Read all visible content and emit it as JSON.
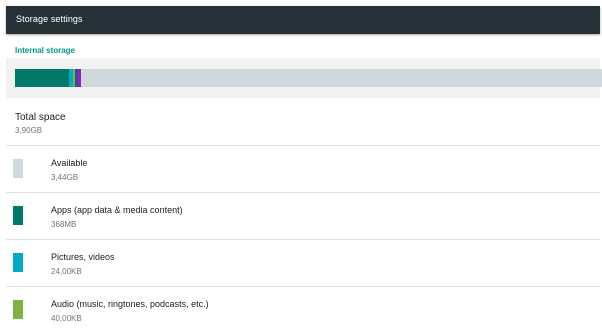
{
  "app_bar": {
    "title": "Storage settings"
  },
  "section_header": "Internal storage",
  "storage_bar": {
    "segments": [
      {
        "name": "apps",
        "fraction": 0.092,
        "color": "#00796B"
      },
      {
        "name": "pictures-videos",
        "fraction": 0.006,
        "color": "#00ACC1"
      },
      {
        "name": "audio",
        "fraction": 0.004,
        "color": "#7CB342"
      },
      {
        "name": "downloads",
        "fraction": 0.005,
        "color": "#3949AB"
      },
      {
        "name": "misc",
        "fraction": 0.005,
        "color": "#8E24AA"
      }
    ],
    "remainder_color": "#CFD8DC"
  },
  "total": {
    "label": "Total space",
    "value": "3,90GB"
  },
  "items": [
    {
      "label": "Available",
      "value": "3,44GB",
      "color": "#CFD8DC"
    },
    {
      "label": "Apps (app data & media content)",
      "value": "368MB",
      "color": "#00796B"
    },
    {
      "label": "Pictures, videos",
      "value": "24,00KB",
      "color": "#00ACC1"
    },
    {
      "label": "Audio (music, ringtones, podcasts, etc.)",
      "value": "40,00KB",
      "color": "#7CB342"
    }
  ]
}
